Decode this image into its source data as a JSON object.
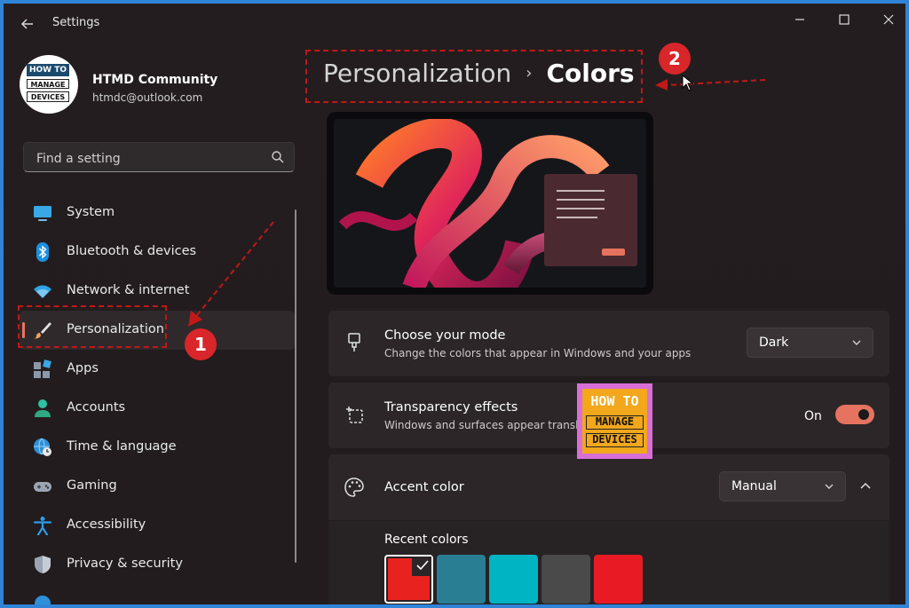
{
  "window": {
    "title": "Settings"
  },
  "profile": {
    "name": "HTMD Community",
    "email": "htmdc@outlook.com",
    "avatar_logo": {
      "line1": "HOW TO",
      "line2": "MANAGE",
      "line3": "DEVICES"
    }
  },
  "search": {
    "placeholder": "Find a setting"
  },
  "sidebar": {
    "items": [
      {
        "label": "System",
        "icon": "system-icon",
        "active": false
      },
      {
        "label": "Bluetooth & devices",
        "icon": "bluetooth-icon",
        "active": false
      },
      {
        "label": "Network & internet",
        "icon": "wifi-icon",
        "active": false
      },
      {
        "label": "Personalization",
        "icon": "brush-icon",
        "active": true
      },
      {
        "label": "Apps",
        "icon": "apps-icon",
        "active": false
      },
      {
        "label": "Accounts",
        "icon": "person-icon",
        "active": false
      },
      {
        "label": "Time & language",
        "icon": "globe-clock-icon",
        "active": false
      },
      {
        "label": "Gaming",
        "icon": "gamepad-icon",
        "active": false
      },
      {
        "label": "Accessibility",
        "icon": "accessibility-icon",
        "active": false
      },
      {
        "label": "Privacy & security",
        "icon": "shield-icon",
        "active": false
      }
    ]
  },
  "breadcrumb": {
    "parent": "Personalization",
    "separator": "›",
    "current": "Colors"
  },
  "annotations": {
    "badge1": "1",
    "badge2": "2",
    "color": "#c11818"
  },
  "settings": {
    "mode": {
      "title": "Choose your mode",
      "subtitle": "Change the colors that appear in Windows and your apps",
      "value": "Dark"
    },
    "transparency": {
      "title": "Transparency effects",
      "subtitle": "Windows and surfaces appear transl",
      "state_label": "On",
      "enabled": true
    },
    "accent": {
      "title": "Accent color",
      "value": "Manual"
    },
    "recent_colors": {
      "title": "Recent colors",
      "colors": [
        "#e8231f",
        "#2a7e93",
        "#00b4c3",
        "#4a4a4a",
        "#e81b25"
      ],
      "selected_index": 0
    }
  },
  "watermark_logo": {
    "line1": "HOW TO",
    "line2": "MANAGE",
    "line3": "DEVICES"
  },
  "colors": {
    "accent": "#e6735f",
    "frame_border": "#2f84d8",
    "background": "#221c1e"
  }
}
